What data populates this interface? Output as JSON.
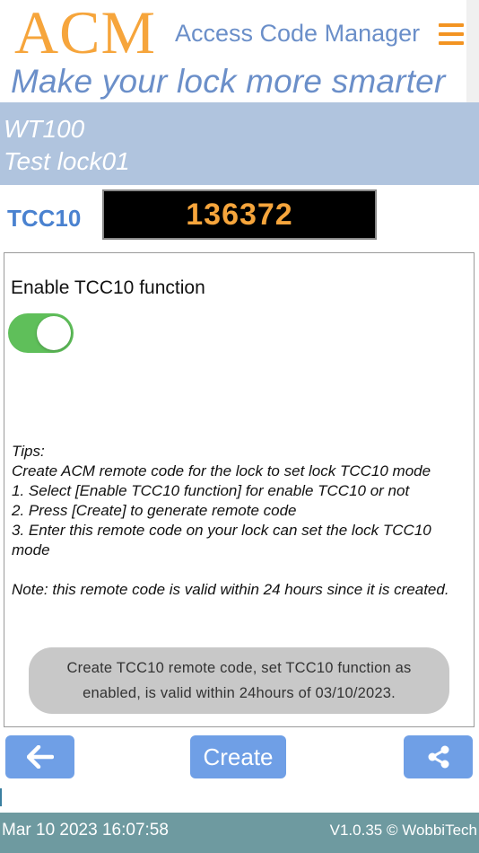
{
  "header": {
    "logo": "ACM",
    "app_title": "Access Code Manager",
    "tagline": "Make your lock more smarter"
  },
  "lock": {
    "model": "WT100",
    "name": "Test lock01"
  },
  "code": {
    "label": "TCC10",
    "value": "136372"
  },
  "panel": {
    "enable_label": "Enable TCC10 function",
    "toggle_on": true,
    "tips": {
      "heading": "Tips:",
      "intro": "Create ACM remote code for the lock to set lock TCC10 mode",
      "step1": "1. Select [Enable TCC10 function] for enable TCC10 or not",
      "step2": "2. Press [Create] to generate remote code",
      "step3": "3. Enter this remote code on your lock can set the lock TCC10 mode",
      "note": "Note: this remote code is valid within 24 hours since it is created."
    },
    "toast": "Create TCC10 remote code, set TCC10 function as enabled, is valid within 24hours of 03/10/2023."
  },
  "actions": {
    "create_label": "Create"
  },
  "footer": {
    "datetime": "Mar 10 2023 16:07:58",
    "version": "V1.0.35 © WobbiTech"
  },
  "icons": {
    "menu": "hamburger-menu-icon",
    "back": "arrow-left-icon",
    "share": "share-icon"
  },
  "colors": {
    "accent_orange": "#f6a53c",
    "title_blue": "#6b8fc9",
    "button_blue": "#6f9fe6",
    "lock_band": "#b0c4de",
    "toggle_green": "#5fbf5a",
    "footer_bar": "#6e9aa0"
  }
}
